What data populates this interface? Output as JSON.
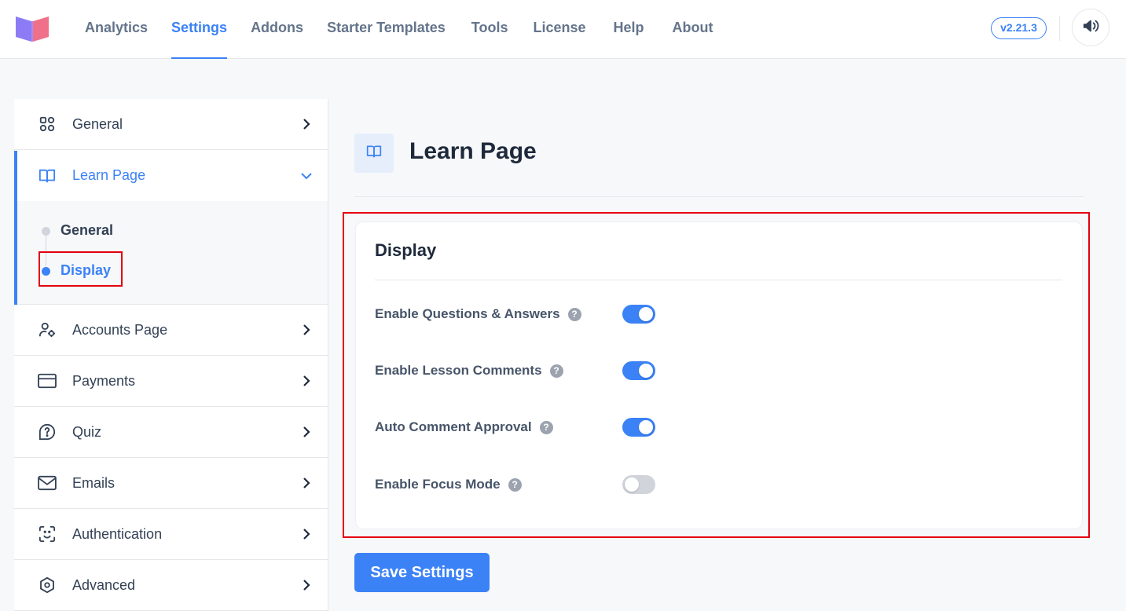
{
  "nav": {
    "items": [
      {
        "label": "Analytics"
      },
      {
        "label": "Settings",
        "active": true
      },
      {
        "label": "Addons"
      },
      {
        "label": "Starter Templates"
      },
      {
        "label": "Tools"
      },
      {
        "label": "License"
      },
      {
        "label": "Help"
      },
      {
        "label": "About"
      }
    ],
    "version": "v2.21.3",
    "icons": {
      "logo": "book-logo",
      "announce": "megaphone-icon"
    }
  },
  "sidebar": {
    "items": [
      {
        "label": "General",
        "icon": "grid-icon"
      },
      {
        "label": "Learn Page",
        "icon": "book-open-icon",
        "expanded": true
      },
      {
        "label": "Accounts Page",
        "icon": "user-gear-icon"
      },
      {
        "label": "Payments",
        "icon": "credit-card-icon"
      },
      {
        "label": "Quiz",
        "icon": "question-bubble-icon"
      },
      {
        "label": "Emails",
        "icon": "envelope-icon"
      },
      {
        "label": "Authentication",
        "icon": "face-scan-icon"
      },
      {
        "label": "Advanced",
        "icon": "hexagon-icon"
      }
    ],
    "submenu": [
      {
        "label": "General",
        "active": false
      },
      {
        "label": "Display",
        "active": true
      }
    ]
  },
  "main": {
    "title": "Learn Page",
    "section": {
      "title": "Display",
      "settings": [
        {
          "label": "Enable Questions & Answers",
          "enabled": true
        },
        {
          "label": "Enable Lesson Comments",
          "enabled": true
        },
        {
          "label": "Auto Comment Approval",
          "enabled": true
        },
        {
          "label": "Enable Focus Mode",
          "enabled": false
        }
      ]
    },
    "save_label": "Save Settings"
  },
  "colors": {
    "accent": "#3b82f6",
    "highlight": "#e3000f",
    "toggle_off": "#d1d5db"
  }
}
